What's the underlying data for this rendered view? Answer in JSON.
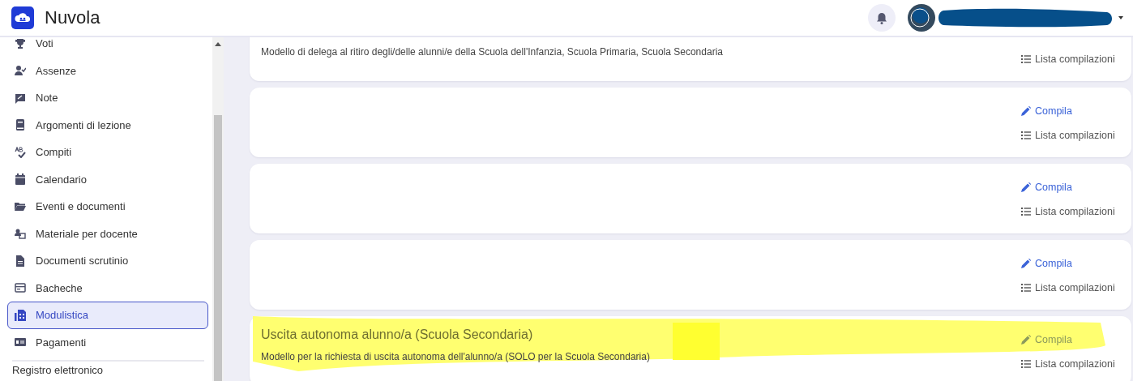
{
  "header": {
    "app_name": "Nuvola"
  },
  "sidebar": {
    "items": [
      {
        "label": "Voti",
        "selected": false
      },
      {
        "label": "Assenze",
        "selected": false
      },
      {
        "label": "Note",
        "selected": false
      },
      {
        "label": "Argomenti di lezione",
        "selected": false
      },
      {
        "label": "Compiti",
        "selected": false
      },
      {
        "label": "Calendario",
        "selected": false
      },
      {
        "label": "Eventi e documenti",
        "selected": false
      },
      {
        "label": "Materiale per docente",
        "selected": false
      },
      {
        "label": "Documenti scrutinio",
        "selected": false
      },
      {
        "label": "Bacheche",
        "selected": false
      },
      {
        "label": "Modulistica",
        "selected": true
      },
      {
        "label": "Pagamenti",
        "selected": false
      }
    ],
    "footer_section": "Registro elettronico"
  },
  "cards": [
    {
      "description": "Modello di delega al ritiro degli/delle alunni/e della Scuola dell'Infanzia, Scuola Primaria, Scuola Secondaria",
      "highlighted": false,
      "actions": [
        {
          "kind": "list",
          "label": "Lista compilazioni"
        }
      ]
    },
    {
      "highlighted": false,
      "actions": [
        {
          "kind": "edit",
          "label": "Compila"
        },
        {
          "kind": "list",
          "label": "Lista compilazioni"
        }
      ]
    },
    {
      "highlighted": false,
      "actions": [
        {
          "kind": "edit",
          "label": "Compila"
        },
        {
          "kind": "list",
          "label": "Lista compilazioni"
        }
      ]
    },
    {
      "highlighted": false,
      "actions": [
        {
          "kind": "edit",
          "label": "Compila"
        },
        {
          "kind": "list",
          "label": "Lista compilazioni"
        }
      ]
    },
    {
      "title": "Uscita autonoma alunno/a (Scuola Secondaria)",
      "description": "Modello per la richiesta di uscita autonoma dell'alunno/a (SOLO per la Scuola Secondaria)",
      "highlighted": true,
      "actions": [
        {
          "kind": "edit",
          "label": "Compila"
        },
        {
          "kind": "list",
          "label": "Lista compilazioni"
        }
      ]
    }
  ]
}
